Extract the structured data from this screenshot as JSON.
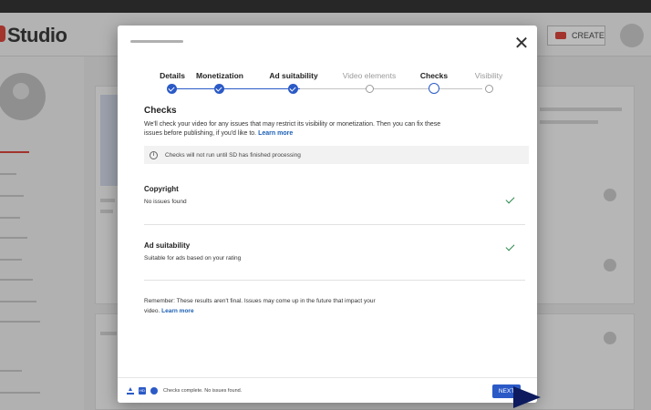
{
  "app": {
    "logo_text": "Studio",
    "create_label": "CREATE"
  },
  "dialog": {
    "steps": [
      {
        "label": "Details",
        "state": "done"
      },
      {
        "label": "Monetization",
        "state": "done"
      },
      {
        "label": "Ad suitability",
        "state": "done"
      },
      {
        "label": "Video elements",
        "state": "future"
      },
      {
        "label": "Checks",
        "state": "current"
      },
      {
        "label": "Visibility",
        "state": "future"
      }
    ],
    "section_title": "Checks",
    "intro_text": "We'll check your video for any issues that may restrict its visibility or monetization. Then you can fix these issues before publishing, if you'd like to.",
    "intro_link": "Learn more",
    "notice_text": "Checks will not run until SD has finished processing",
    "checks": [
      {
        "title": "Copyright",
        "subtitle": "No issues found"
      },
      {
        "title": "Ad suitability",
        "subtitle": "Suitable for ads based on your rating"
      }
    ],
    "remember_text": "Remember: These results aren't final. Issues may come up in the future that impact your video.",
    "remember_link": "Learn more",
    "footer_status": "Checks complete. No issues found.",
    "next_label": "NEXT"
  },
  "colors": {
    "accent": "#2b5ac7",
    "brand": "#d93025",
    "success": "#2a8a4a"
  }
}
